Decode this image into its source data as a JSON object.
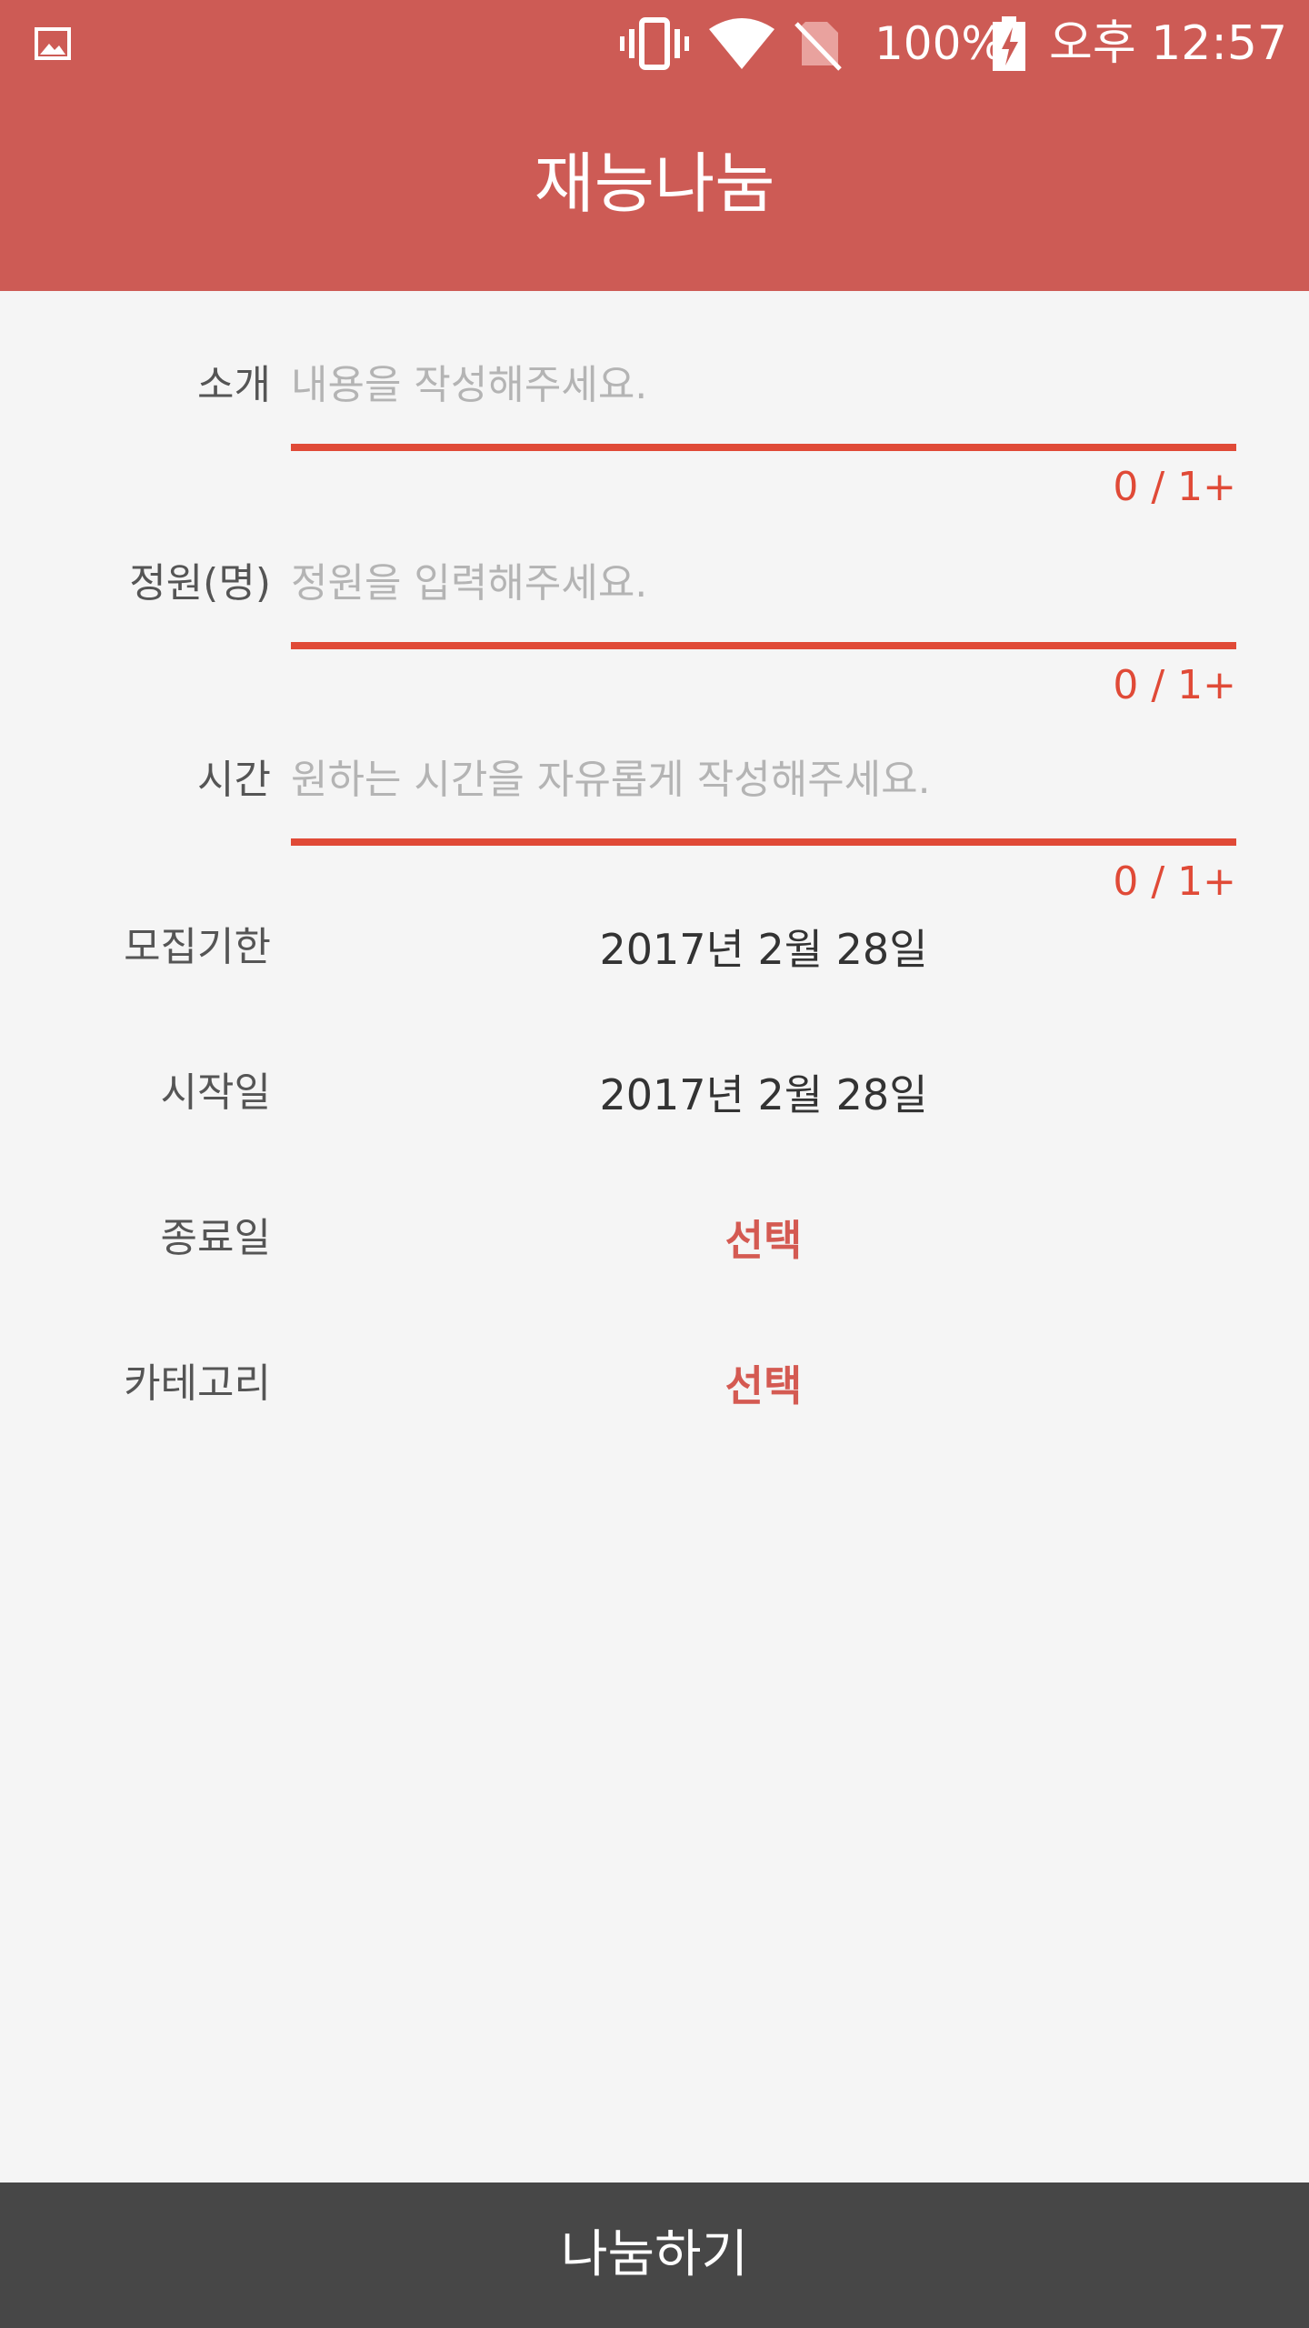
{
  "status_bar": {
    "battery_text": "100%",
    "time": "오후 12:57",
    "icons": [
      "gallery-icon",
      "vibrate-icon",
      "wifi-icon",
      "no-sim-icon",
      "battery-charging-icon"
    ]
  },
  "toolbar": {
    "title": "재능나눔"
  },
  "form": {
    "intro": {
      "label": "소개",
      "placeholder": "내용을 작성해주세요.",
      "value": "",
      "counter": "0 / 1+"
    },
    "capacity": {
      "label": "정원(명)",
      "placeholder": "정원을 입력해주세요.",
      "value": "",
      "counter": "0 / 1+"
    },
    "time": {
      "label": "시간",
      "placeholder": "원하는 시간을 자유롭게 작성해주세요.",
      "value": "",
      "counter": "0 / 1+"
    },
    "deadline": {
      "label": "모집기한",
      "value": "2017년 2월 28일"
    },
    "start_date": {
      "label": "시작일",
      "value": "2017년 2월 28일"
    },
    "end_date": {
      "label": "종료일",
      "value": "선택"
    },
    "category": {
      "label": "카테고리",
      "value": "선택"
    }
  },
  "submit": {
    "label": "나눔하기"
  },
  "colors": {
    "primary": "#cd5b55",
    "accent": "#e04a37",
    "select_text": "#d45a52",
    "bottom_bar": "#474747",
    "background": "#f5f5f5"
  }
}
